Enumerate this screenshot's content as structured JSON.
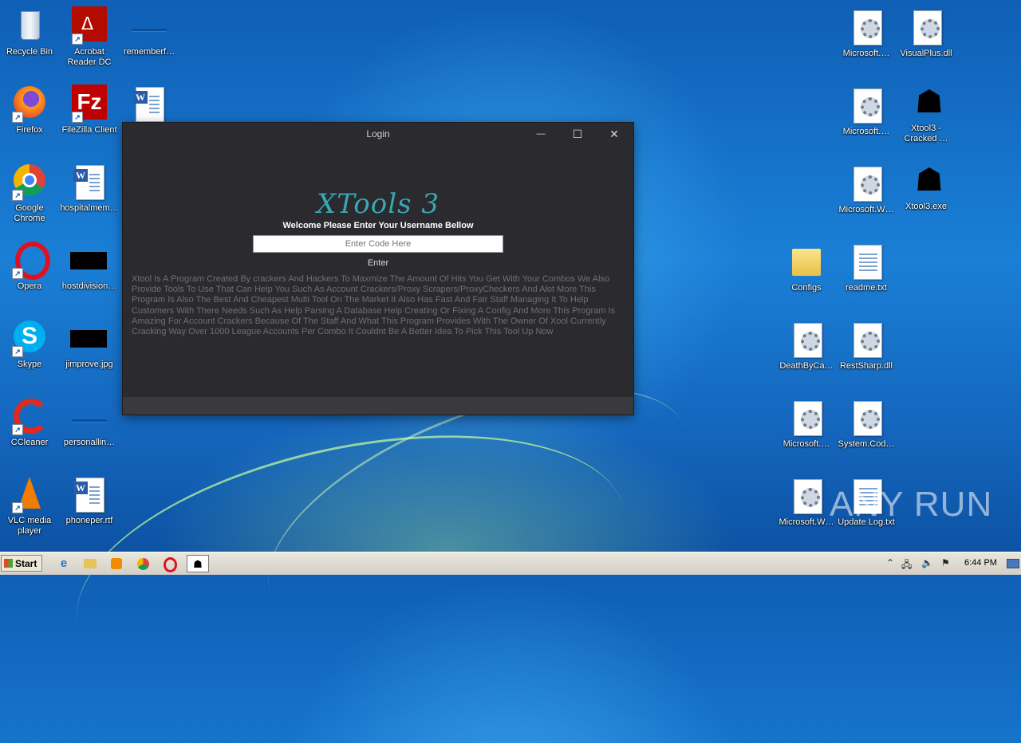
{
  "desktop": {
    "left_icons": [
      {
        "name": "recycle-bin",
        "label": "Recycle Bin",
        "icon": "recycle-bin-icon"
      },
      {
        "name": "acrobat",
        "label": "Acrobat Reader DC",
        "icon": "acrobat-icon"
      },
      {
        "name": "rememberf",
        "label": "rememberf…",
        "icon": "image-file-icon"
      },
      {
        "name": "firefox",
        "label": "Firefox",
        "icon": "firefox-icon"
      },
      {
        "name": "filezilla",
        "label": "FileZilla Client",
        "icon": "filezilla-icon"
      },
      {
        "name": "word-doc-1",
        "label": "",
        "icon": "word-document-icon"
      },
      {
        "name": "chrome",
        "label": "Google Chrome",
        "icon": "chrome-icon"
      },
      {
        "name": "hospitalmem",
        "label": "hospitalmem…",
        "icon": "word-document-icon"
      },
      {
        "name": "opera",
        "label": "Opera",
        "icon": "opera-icon"
      },
      {
        "name": "hostdivision",
        "label": "hostdivision…",
        "icon": "image-file-icon"
      },
      {
        "name": "skype",
        "label": "Skype",
        "icon": "skype-icon"
      },
      {
        "name": "jimprove",
        "label": "jimprove.jpg",
        "icon": "image-file-icon"
      },
      {
        "name": "ccleaner",
        "label": "CCleaner",
        "icon": "ccleaner-icon"
      },
      {
        "name": "personallin",
        "label": "personallin…",
        "icon": "image-file-icon"
      },
      {
        "name": "vlc",
        "label": "VLC media player",
        "icon": "vlc-icon"
      },
      {
        "name": "phoneper",
        "label": "phoneper.rtf",
        "icon": "word-document-icon"
      }
    ],
    "right_icons": [
      {
        "name": "microsoft-1",
        "label": "Microsoft.…",
        "icon": "dll-gear-icon"
      },
      {
        "name": "visualplus",
        "label": "VisualPlus.dll",
        "icon": "dll-gear-icon"
      },
      {
        "name": "microsoft-2",
        "label": "Microsoft.…",
        "icon": "dll-gear-icon"
      },
      {
        "name": "xtool3-cracked",
        "label": "Xtool3 - Cracked …",
        "icon": "reaper-icon"
      },
      {
        "name": "microsoft-w-1",
        "label": "Microsoft.W…",
        "icon": "dll-gear-icon"
      },
      {
        "name": "xtool3-exe",
        "label": "Xtool3.exe",
        "icon": "reaper-icon"
      },
      {
        "name": "configs",
        "label": "Configs",
        "icon": "folder-icon"
      },
      {
        "name": "readme",
        "label": "readme.txt",
        "icon": "text-file-icon"
      },
      {
        "name": "deathbyca",
        "label": "DeathByCa…",
        "icon": "dll-gear-icon"
      },
      {
        "name": "restsharp",
        "label": "RestSharp.dll",
        "icon": "dll-gear-icon"
      },
      {
        "name": "microsoft-3",
        "label": "Microsoft.…",
        "icon": "dll-gear-icon"
      },
      {
        "name": "system-cod",
        "label": "System.Cod…",
        "icon": "dll-gear-icon"
      },
      {
        "name": "microsoft-w-2",
        "label": "Microsoft.W…",
        "icon": "dll-gear-icon"
      },
      {
        "name": "update-log",
        "label": "Update Log.txt",
        "icon": "text-file-icon"
      }
    ],
    "watermark": "ANY RUN"
  },
  "login_window": {
    "title": "Login",
    "logo_text": "XTools 3",
    "welcome": "Welcome Please Enter Your Username Bellow",
    "input_placeholder": "Enter Code Here",
    "enter_label": "Enter",
    "description": "Xtool Is A Program Created By crackers And Hackers To Maxmize The Amount Of Hits You Get With Your Combos We Also Provide Tools To Use That Can Help You Such As Account Crackers/Proxy Scrapers/ProxyCheckers And Alot More This Program Is Also The Best And Cheapest Multi Tool On The Market It Also Has Fast And Fair Staff Managing It To Help Customers With There Needs Such As Help Parsing A Database Help Creating Or Fixing A Config And More This Program Is Amazing For Account Crackers Because Of The Staff And What This Program Provides With The Owner Of Xool Currently Cracking Way Over 1000 League Accounts Per Combo It Couldnt Be A Better Idea To Pick This Tool Up Now",
    "minimize_glyph": "—",
    "maximize_glyph": "☐",
    "close_glyph": "✕"
  },
  "taskbar": {
    "start_label": "Start",
    "apps": [
      "ie-icon",
      "explorer-icon",
      "media-player-icon",
      "chrome-icon",
      "opera-icon",
      "xtool-reaper-icon"
    ],
    "clock": "6:44 PM"
  }
}
